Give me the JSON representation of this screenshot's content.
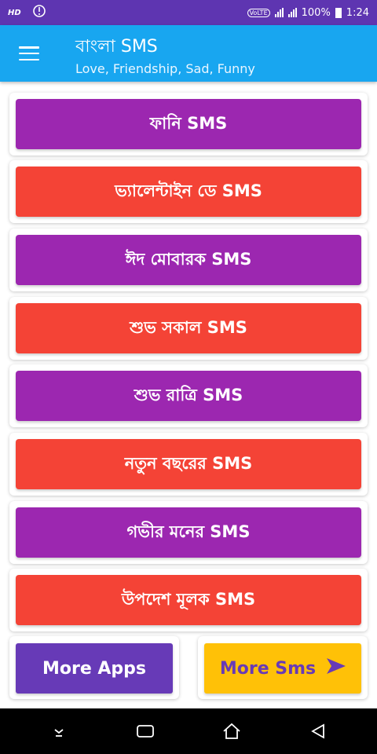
{
  "statusbar": {
    "hd": "HD",
    "network": "VoLTE",
    "battery": "100%",
    "time": "1:24"
  },
  "appbar": {
    "title": "বাংলা SMS",
    "subtitle": "Love, Friendship, Sad, Funny"
  },
  "categories": [
    {
      "label": "ফানি SMS",
      "color": "#9c27b0"
    },
    {
      "label": "ভ্যালেন্টাইন ডে SMS",
      "color": "#f44336"
    },
    {
      "label": "ঈদ মোবারক SMS",
      "color": "#9c27b0"
    },
    {
      "label": "শুভ সকাল SMS",
      "color": "#f44336"
    },
    {
      "label": "শুভ রাত্রি SMS",
      "color": "#9c27b0"
    },
    {
      "label": "নতুন বছরের SMS",
      "color": "#f44336"
    },
    {
      "label": "গভীর মনের SMS",
      "color": "#9c27b0"
    },
    {
      "label": "উপদেশ মূলক SMS",
      "color": "#f44336"
    }
  ],
  "footer": {
    "more_apps": "More Apps",
    "more_sms": "More Sms"
  },
  "colors": {
    "statusbar": "#5e35b1",
    "appbar": "#18a6f0",
    "more_apps": "#673ab7",
    "more_sms": "#ffc107"
  },
  "icons": [
    "menu-icon",
    "arrow-right-icon",
    "nav-down-icon",
    "recent-apps-icon",
    "home-icon",
    "back-icon"
  ]
}
